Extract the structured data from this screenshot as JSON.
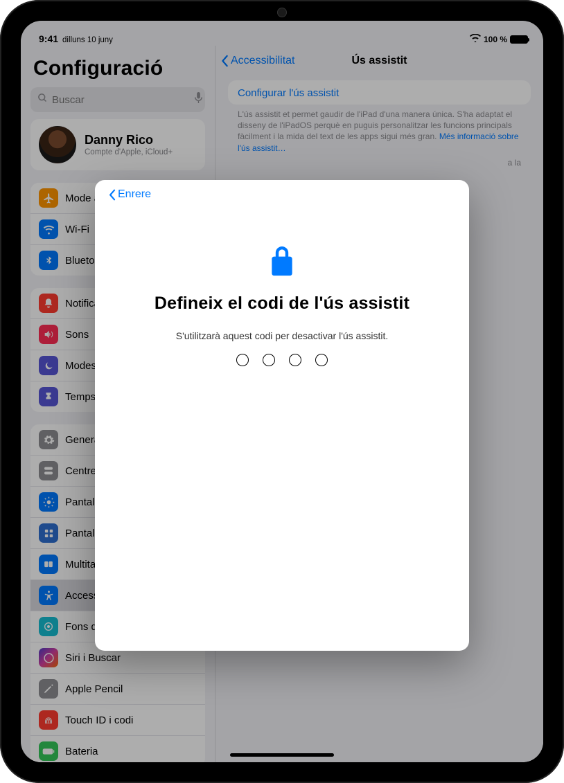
{
  "status": {
    "time": "9:41",
    "date": "dilluns 10 juny",
    "battery_text": "100 %"
  },
  "sidebar": {
    "title": "Configuració",
    "search_placeholder": "Buscar",
    "profile": {
      "name": "Danny Rico",
      "sub": "Compte d'Apple, iCloud+"
    },
    "group_conn": [
      {
        "label": "Mode avió",
        "icon": "airplane-icon",
        "bg": "#ff9500"
      },
      {
        "label": "Wi‑Fi",
        "icon": "wifi-icon",
        "bg": "#007aff"
      },
      {
        "label": "Bluetooth",
        "icon": "bluetooth-icon",
        "bg": "#007aff"
      }
    ],
    "group_notif": [
      {
        "label": "Notificacions",
        "icon": "bell-icon",
        "bg": "#ff3b30"
      },
      {
        "label": "Sons",
        "icon": "sound-icon",
        "bg": "#ff2d55"
      },
      {
        "label": "Modes de concentració",
        "icon": "moon-icon",
        "bg": "#5856d6"
      },
      {
        "label": "Temps d'ús",
        "icon": "hourglass-icon",
        "bg": "#5856d6"
      }
    ],
    "group_general": [
      {
        "label": "General",
        "icon": "gear-icon",
        "bg": "#8e8e93"
      },
      {
        "label": "Centre de control",
        "icon": "switches-icon",
        "bg": "#8e8e93"
      },
      {
        "label": "Pantalla i brillantor",
        "icon": "brightness-icon",
        "bg": "#007aff"
      },
      {
        "label": "Pantalla d'inici i biblioteca d'apps",
        "icon": "grid-icon",
        "bg": "#2f6fd0"
      },
      {
        "label": "Multitasca i gestos",
        "icon": "multitask-icon",
        "bg": "#007aff"
      },
      {
        "label": "Accessibilitat",
        "icon": "accessibility-icon",
        "bg": "#007aff",
        "selected": true
      },
      {
        "label": "Fons de pantalla",
        "icon": "wallpaper-icon",
        "bg": "#17bdd1"
      },
      {
        "label": "Siri i Buscar",
        "icon": "siri-icon",
        "bg": "linear-gradient(135deg,#4f3cc9,#d6409f,#f76808)"
      },
      {
        "label": "Apple Pencil",
        "icon": "pencil-icon",
        "bg": "#8e8e93"
      },
      {
        "label": "Touch ID i codi",
        "icon": "touchid-icon",
        "bg": "#ff3b30"
      },
      {
        "label": "Bateria",
        "icon": "battery-icon",
        "bg": "#34c759"
      }
    ]
  },
  "main": {
    "back": "Accessibilitat",
    "title": "Ús assistit",
    "config_link": "Configurar l'ús assistit",
    "desc": "L'ús assistit et permet gaudir de l'iPad d'una manera única. S'ha adaptat el disseny de l'iPadOS perquè en puguis personalitzar les funcions principals fàcilment i la mida del text de les apps sigui més gran.",
    "desc_link": "Més informació sobre l'ús assistit…",
    "desc_extra": "a la"
  },
  "sheet": {
    "back": "Enrere",
    "title": "Defineix el codi de l'ús assistit",
    "subtitle": "S'utilitzarà aquest codi per desactivar l'ús assistit.",
    "digits": 4
  }
}
